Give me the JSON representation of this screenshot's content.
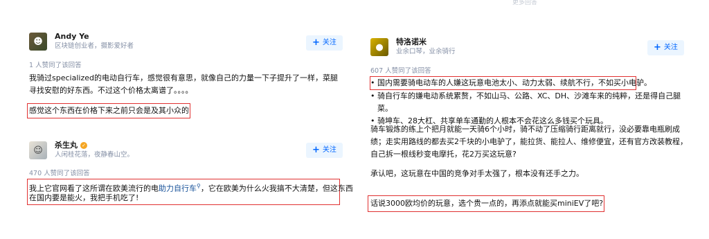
{
  "left": {
    "answer1": {
      "author_name": "Andy Ye",
      "author_bio": "区块链创业者，摄影爱好者",
      "follow_label": "关注",
      "upvotes": "1 人赞同了该回答",
      "text": "我骑过specialized的电动自行车，感觉很有意思，就像自己的力量一下子提升了一样，菜腿寻找安慰的好东西。不过这个价格太离谱了。。。。",
      "highlight": "感觉这个东西在价格下来之前只会是及其小众的"
    },
    "answer2": {
      "author_name": "杀生丸",
      "author_bio": "人闲桂花落，夜静春山空。",
      "follow_label": "关注",
      "upvotes": "470 人赞同了该回答",
      "highlight_part1": "我上它官网看了这所谓在欧美流行的电",
      "highlight_link": "助力自行车",
      "highlight_part2": "，它在欧美为什么火我搞不大清楚，但这东西",
      "highlight_line2": "在国内要是能火，我把手机吃了!"
    }
  },
  "right": {
    "faded_header": "更多回答",
    "author_name": "特洛诺米",
    "author_bio": "业余口琴，业余骑行",
    "follow_label": "关注",
    "upvotes": "607 人赞同了该回答",
    "bullet_highlight": "国内需要骑电动车的人嫌这玩意电池太小、动力太弱、续航不行，不如买小电驴。",
    "bullets": [
      "骑自行车的嫌电动系统累赘，不如山马、公路、XC、DH、沙滩车来的纯粹，还是得自己腿菜。",
      "骑坤车、28大杠、共享单车通勤的人根本不会花这么多钱买个玩具。"
    ],
    "para1": "骑车锻炼的练上个把月就能一天骑6个小时，骑不动了压缩骑行距离就行，没必要靠电瓶刷成绩；走实用路线的都去买2千块的小电驴了，能拉货、能拉人、维修便宜，还有官方改装教程，自己拆一根线秒变电摩托，花2万买这玩意?",
    "para2": "承认吧，这玩意在中国的竞争对手太强了，根本没有还手之力。",
    "highlight": "话说3000欧均价的玩意，选个贵一点的，再添点就能买miniEV了吧?"
  },
  "colors": {
    "highlight_border": "#e03030",
    "follow_bg": "#ebf5ff",
    "follow_text": "#0066ff",
    "meta_text": "#8590a6",
    "link": "#175199"
  },
  "icons": {
    "follow": "plus-icon",
    "badge": "verified-badge-icon",
    "link_search": "search-icon"
  }
}
